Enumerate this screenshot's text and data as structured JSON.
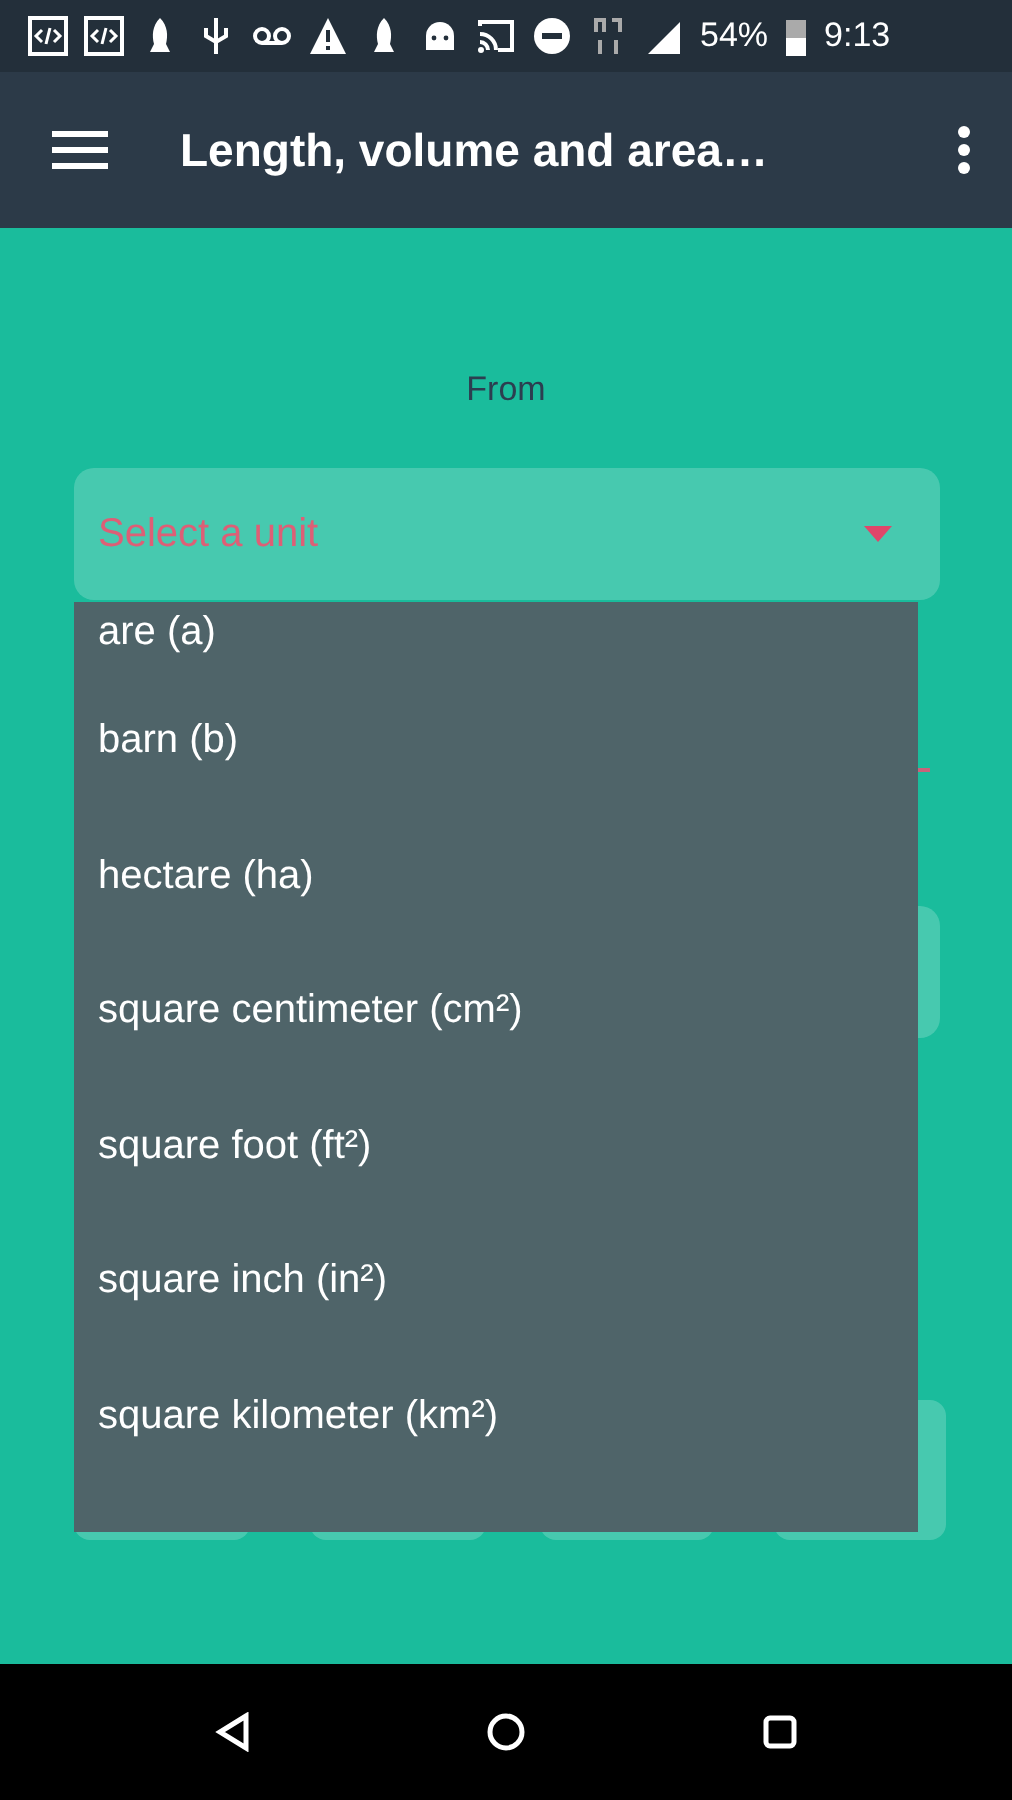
{
  "status_bar": {
    "battery": "54%",
    "time": "9:13"
  },
  "app_bar": {
    "title": "Length, volume and area…"
  },
  "from_label": "From",
  "from_select": {
    "placeholder": "Select a unit",
    "expanded": true
  },
  "dropdown": {
    "items": [
      {
        "label": "are (a)"
      },
      {
        "label": "barn (b)"
      },
      {
        "label": "hectare (ha)"
      },
      {
        "label": "square centimeter (cm²)"
      },
      {
        "label": "square foot (ft²)"
      },
      {
        "label": "square inch (in²)"
      },
      {
        "label": "square kilometer (km²)"
      }
    ]
  }
}
